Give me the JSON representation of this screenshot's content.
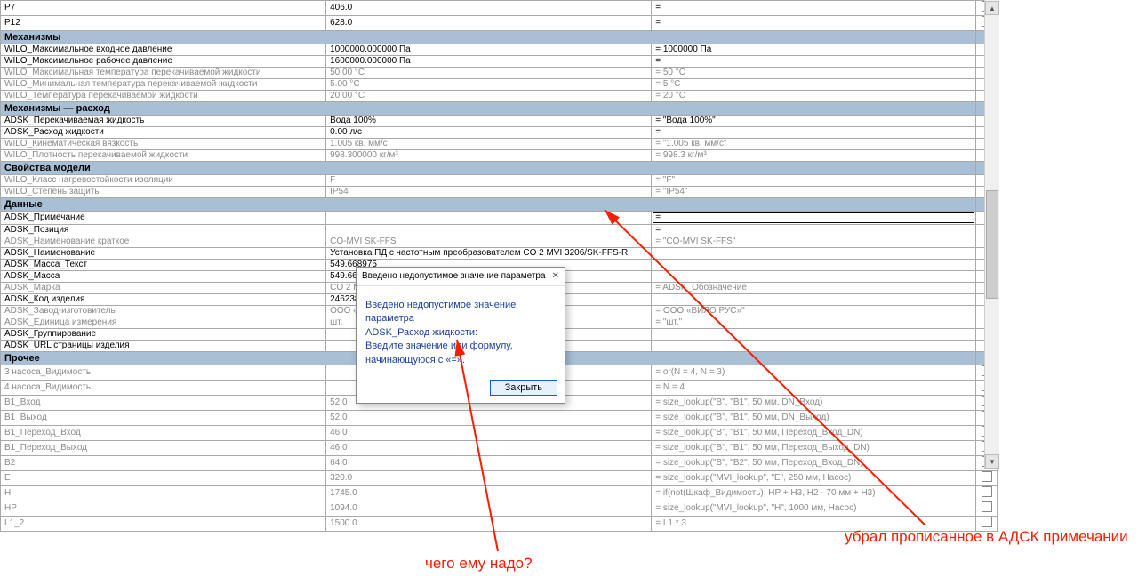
{
  "rows": [
    {
      "type": "row",
      "p": "P7",
      "v": "406.0",
      "f": "=",
      "chk": true
    },
    {
      "type": "row",
      "p": "P12",
      "v": "628.0",
      "f": "=",
      "chk": true
    },
    {
      "type": "group",
      "label": "Механизмы"
    },
    {
      "type": "row",
      "p": "WILO_Максимальное входное давление",
      "v": "1000000.000000 Па",
      "f": "= 1000000 Па",
      "chk": false,
      "gray": false
    },
    {
      "type": "row",
      "p": "WILO_Максимальное рабочее давление",
      "v": "1600000.000000 Па",
      "f": "=",
      "chk": false
    },
    {
      "type": "row",
      "p": "WILO_Максимальная температура перекачиваемой жидкости",
      "v": "50.00 °C",
      "f": "= 50 °C",
      "chk": false,
      "gray": true
    },
    {
      "type": "row",
      "p": "WILO_Минимальная температура перекачиваемой жидкости",
      "v": "5.00 °C",
      "f": "= 5 °C",
      "chk": false,
      "gray": true
    },
    {
      "type": "row",
      "p": "WILO_Температура перекачиваемой жидкости",
      "v": "20.00 °C",
      "f": "= 20 °C",
      "chk": false,
      "gray": true
    },
    {
      "type": "group",
      "label": "Механизмы — расход"
    },
    {
      "type": "row",
      "p": "ADSK_Перекачиваемая жидкость",
      "v": "Вода 100%",
      "f": "= \"Вода 100%\"",
      "chk": false
    },
    {
      "type": "row",
      "p": "ADSK_Расход жидкости",
      "v": "0.00 л/с",
      "f": "=",
      "chk": false
    },
    {
      "type": "row",
      "p": "WILO_Кинематическая вязкость",
      "v": "1.005 кв. мм/с",
      "f": "= \"1.005 кв. мм/с\"",
      "chk": false,
      "gray": true
    },
    {
      "type": "row",
      "p": "WILO_Плотность перекачиваемой жидкости",
      "v": "998.300000 кг/м³",
      "f": "= 998.3 кг/м³",
      "chk": false,
      "gray": true
    },
    {
      "type": "group",
      "label": "Свойства модели"
    },
    {
      "type": "row",
      "p": "WILO_Класс нагревостойкости изоляции",
      "v": "F",
      "f": "= \"F\"",
      "chk": false,
      "gray": true
    },
    {
      "type": "row",
      "p": "WILO_Степень защиты",
      "v": "IP54",
      "f": "= \"IP54\"",
      "chk": false,
      "gray": true
    },
    {
      "type": "group",
      "label": "Данные"
    },
    {
      "type": "row",
      "p": "ADSK_Примечание",
      "v": "",
      "f": "=",
      "chk": false,
      "editing": true
    },
    {
      "type": "row",
      "p": "ADSK_Позиция",
      "v": "",
      "f": "=",
      "chk": false
    },
    {
      "type": "row",
      "p": "ADSK_Наименование краткое",
      "v": "CO-MVI SK-FFS",
      "f": "= \"CO-MVI SK-FFS\"",
      "chk": false,
      "gray": true
    },
    {
      "type": "row",
      "p": "ADSK_Наименование",
      "v": "Установка ПД с частотным преобразователем CO 2 MVI 3206/SK-FFS-R",
      "f": "",
      "chk": false
    },
    {
      "type": "row",
      "p": "ADSK_Масса_Текст",
      "v": "549.668975",
      "f": "",
      "chk": false
    },
    {
      "type": "row",
      "p": "ADSK_Масса",
      "v": "549.668975",
      "f": "",
      "chk": false
    },
    {
      "type": "row",
      "p": "ADSK_Марка",
      "v": "CO 2 MVI 3206/SK-FFS",
      "f": "= ADSK_Обозначение",
      "chk": false,
      "gray": true,
      "trunc": "CO 2 MVI 3206/SK-FF"
    },
    {
      "type": "row",
      "p": "ADSK_Код изделия",
      "v": "2462385",
      "f": "",
      "chk": false
    },
    {
      "type": "row",
      "p": "ADSK_Завод-изготовитель",
      "v": "ООО «ВИЛО РУС»",
      "f": "= ООО «ВИЛО РУС»\"",
      "chk": false,
      "gray": true
    },
    {
      "type": "row",
      "p": "ADSK_Единица измерения",
      "v": "шт.",
      "f": "= \"шт.\"",
      "chk": false,
      "gray": true
    },
    {
      "type": "row",
      "p": "ADSK_Группирование",
      "v": "",
      "f": "",
      "chk": false
    },
    {
      "type": "row",
      "p": "ADSK_URL страницы изделия",
      "v": "",
      "f": "",
      "chk": false
    },
    {
      "type": "group",
      "label": "Прочее"
    },
    {
      "type": "row",
      "p": "3 насоса_Видимость",
      "v": "",
      "f": "= or(N = 4, N = 3)",
      "chk": true,
      "chkcell": true,
      "gray": true
    },
    {
      "type": "row",
      "p": "4 насоса_Видимость",
      "v": "",
      "f": "= N = 4",
      "chk": true,
      "chkcell": true,
      "gray": true
    },
    {
      "type": "row",
      "p": "B1_Вход",
      "v": "52.0",
      "f": "= size_lookup(\"B\", \"B1\", 50 мм, DN_Вход)",
      "chk": true,
      "gray": true
    },
    {
      "type": "row",
      "p": "B1_Выход",
      "v": "52.0",
      "f": "= size_lookup(\"B\", \"B1\", 50 мм, DN_Выход)",
      "chk": true,
      "gray": true
    },
    {
      "type": "row",
      "p": "B1_Переход_Вход",
      "v": "46.0",
      "f": "= size_lookup(\"B\", \"B1\", 50 мм, Переход_Вход_DN)",
      "chk": true,
      "gray": true
    },
    {
      "type": "row",
      "p": "B1_Переход_Выход",
      "v": "46.0",
      "f": "= size_lookup(\"B\", \"B1\", 50 мм, Переход_Выход_DN)",
      "chk": true,
      "gray": true
    },
    {
      "type": "row",
      "p": "B2",
      "v": "64.0",
      "f": "= size_lookup(\"B\", \"B2\", 50 мм, Переход_Вход_DN)",
      "chk": true,
      "gray": true
    },
    {
      "type": "row",
      "p": "E",
      "v": "320.0",
      "f": "= size_lookup(\"MVI_lookup\", \"E\", 250 мм, Насос)",
      "chk": true,
      "gray": true
    },
    {
      "type": "row",
      "p": "H",
      "v": "1745.0",
      "f": "= if(not(Шкаф_Видимость), HP + H3, H2 - 70 мм + H3)",
      "chk": true,
      "gray": true
    },
    {
      "type": "row",
      "p": "HP",
      "v": "1094.0",
      "f": "= size_lookup(\"MVI_lookup\", \"H\", 1000 мм, Насос)",
      "chk": true,
      "gray": true
    },
    {
      "type": "row",
      "p": "L1_2",
      "v": "1500.0",
      "f": "= L1 * 3",
      "chk": true,
      "gray": true
    }
  ],
  "dialog": {
    "title": "Введено недопустимое значение параметра",
    "line1": "Введено недопустимое значение параметра",
    "line2": "ADSK_Расход жидкости:",
    "line3": "Введите значение или формулу,",
    "line4": "начинающуюся с «=».",
    "button": "Закрыть",
    "close_x": "✕"
  },
  "collapse_glyph": "⌃",
  "annotations": {
    "bottom": "чего ему надо?",
    "right": "убрал прописанное в АДСК примечании"
  }
}
